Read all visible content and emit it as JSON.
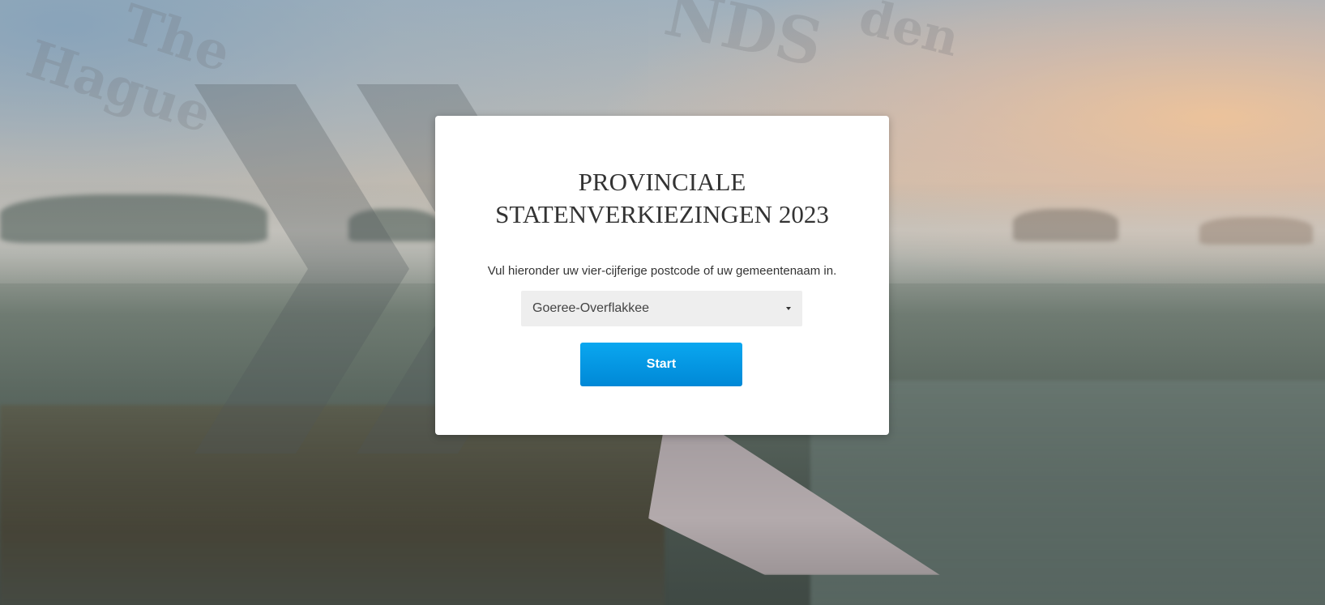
{
  "background": {
    "description_icon": "misty-landscape-image",
    "chevron_icon": "double-chevron-right-icon"
  },
  "card": {
    "title_line1": "PROVINCIALE",
    "title_line2": "STATENVERKIEZINGEN 2023",
    "instruction": "Vul hieronder uw vier-cijferige postcode of uw gemeentenaam in.",
    "municipality_select": {
      "selected_value": "Goeree-Overflakkee"
    },
    "start_label": "Start"
  },
  "colors": {
    "accent": "#0099e0",
    "card_bg": "#ffffff",
    "select_bg": "#eeeeee",
    "text": "#333333"
  }
}
